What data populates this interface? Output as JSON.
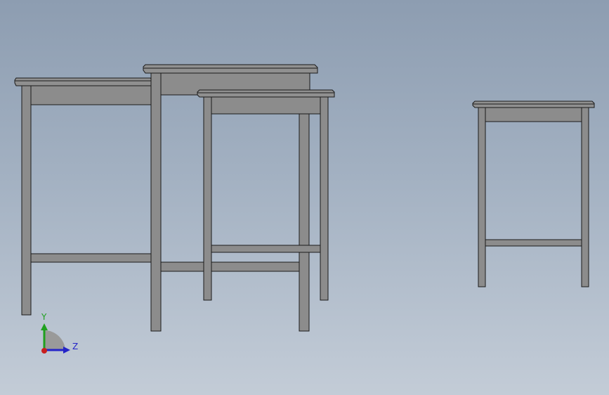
{
  "viewport": {
    "background_top": "#8d9db1",
    "background_bottom": "#c3ccd7"
  },
  "scene": {
    "content": "nesting-tables-cad-model",
    "part_color": "#8c8c8c",
    "edge_color": "#1a1a1a"
  },
  "triad": {
    "y_label": "Y",
    "z_label": "Z",
    "y_color": "#1fa01f",
    "z_color": "#2424c8",
    "x_color": "#c81e1e"
  }
}
